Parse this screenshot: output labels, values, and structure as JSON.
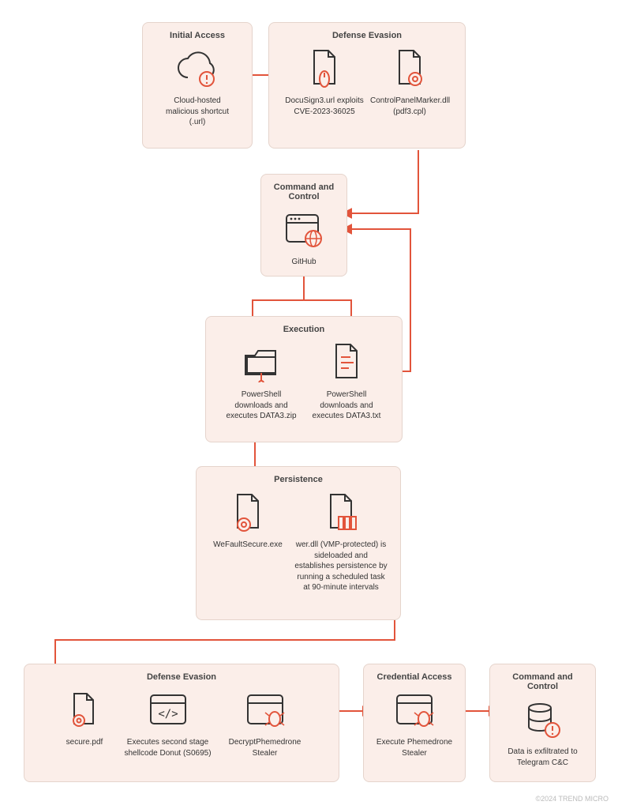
{
  "footer": "©2024 TREND MICRO",
  "boxes": {
    "initialAccess": {
      "title": "Initial Access",
      "node1": "Cloud-hosted malicious shortcut (.url)"
    },
    "defenseEvasion1": {
      "title": "Defense Evasion",
      "node1": "DocuSign3.url exploits CVE-2023-36025",
      "node2": "ControlPanelMarker.dll (pdf3.cpl)"
    },
    "c2_1": {
      "title": "Command and Control",
      "node1": "GitHub"
    },
    "execution": {
      "title": "Execution",
      "node1": "PowerShell downloads and executes DATA3.zip",
      "node2": "PowerShell downloads and executes DATA3.txt"
    },
    "persistence": {
      "title": "Persistence",
      "node1": "WeFaultSecure.exe",
      "node2": "wer.dll (VMP-protected) is sideloaded and establishes persistence by running a scheduled task at 90-minute intervals"
    },
    "defenseEvasion2": {
      "title": "Defense Evasion",
      "node1": "secure.pdf",
      "node2": "Executes second stage shellcode Donut (S0695)",
      "node3": "DecryptPhemedrone Stealer"
    },
    "credAccess": {
      "title": "Credential Access",
      "node1": "Execute Phemedrone Stealer"
    },
    "c2_2": {
      "title": "Command and Control",
      "node1": "Data is exfiltrated to Telegram C&C"
    }
  }
}
